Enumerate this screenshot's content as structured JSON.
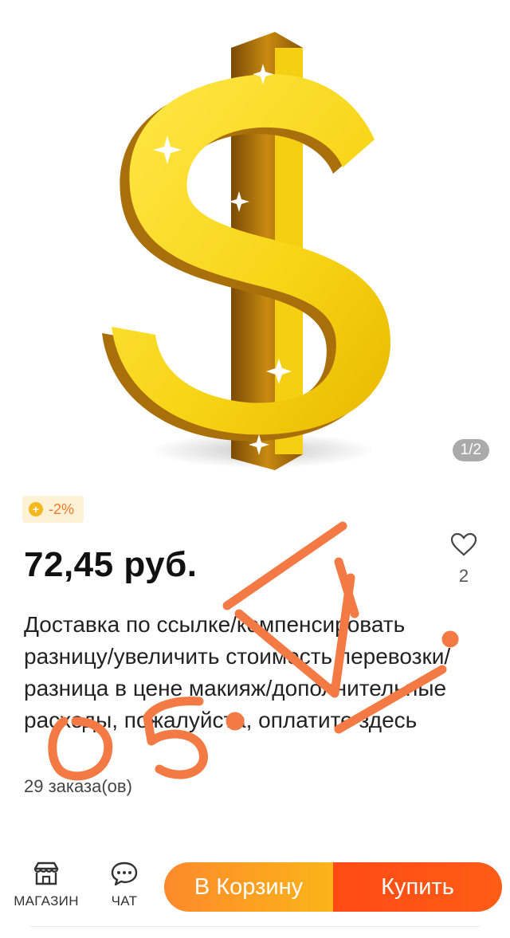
{
  "gallery": {
    "counter": "1/2",
    "image_icon": "dollar-sign-icon"
  },
  "discount": {
    "icon": "coin-icon",
    "text": "-2%"
  },
  "product": {
    "price": "72,45 руб.",
    "wishlist_count": "2",
    "title": "Доставка по ссылке/компенсировать разницу/увеличить стоимость перевозки/разница в цене макияж/дополнительные расходы, пожалуйста, оплатите здесь",
    "orders": "29 заказа(ов)"
  },
  "scribble": {
    "color": "#f47a45"
  },
  "bottom_bar": {
    "shop_label": "МАГАЗИН",
    "chat_label": "ЧАТ",
    "cart_label": "В Корзину",
    "buy_label": "Купить"
  }
}
